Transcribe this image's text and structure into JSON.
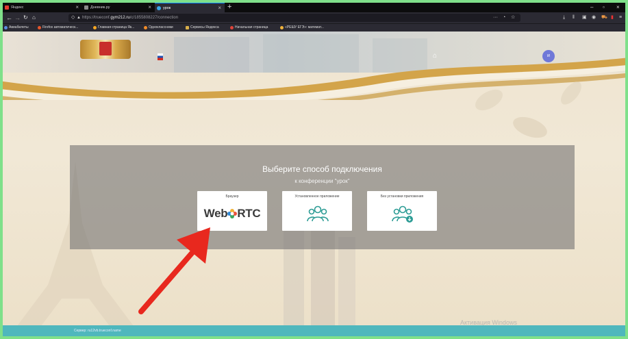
{
  "browser": {
    "tabs": [
      {
        "label": "Яндекс",
        "favicon_color": "#e23b2e",
        "active": false
      },
      {
        "label": "Дневник.ру",
        "favicon_color": "#8a8a8a",
        "active": false
      },
      {
        "label": "урок",
        "favicon_color": "#3aa7e8",
        "active": true
      }
    ],
    "url_prefix": "https://trueconf.",
    "url_host": "gym212.ru",
    "url_path": "/c/1855808227/connection",
    "bookmarks": [
      {
        "label": "Авиабилеты",
        "color": "#5b8de0"
      },
      {
        "label": "Firefox автоматическ...",
        "color": "#e8572b"
      },
      {
        "label": "Главная страница Як...",
        "color": "#f5a623"
      },
      {
        "label": "Одноклассники",
        "color": "#f28c28"
      },
      {
        "label": "Сервисы Яндекса",
        "color": "#d9b04a"
      },
      {
        "label": "Начальная страница",
        "color": "#e0443a"
      },
      {
        "label": "«РЕШУ ЕГЭ»: математ...",
        "color": "#f0b33b"
      }
    ]
  },
  "site": {
    "avatar_letter": "и",
    "panel": {
      "title": "Выберите способ подключения",
      "subtitle": "к конференции \"урок\"",
      "options": [
        {
          "label": "Браузер",
          "logo_text_a": "Web",
          "logo_text_b": "RTC"
        },
        {
          "label": "Установленное приложение"
        },
        {
          "label": "Без установки приложения"
        }
      ]
    },
    "footer_text": "Сервер: ru12vb.trueconf.name",
    "watermark": "Активация Windows"
  },
  "colors": {
    "arrow": "#e8281e",
    "footer": "#4fb7bd",
    "avatar": "#6f78d8",
    "people_icon": "#2c9c95"
  }
}
